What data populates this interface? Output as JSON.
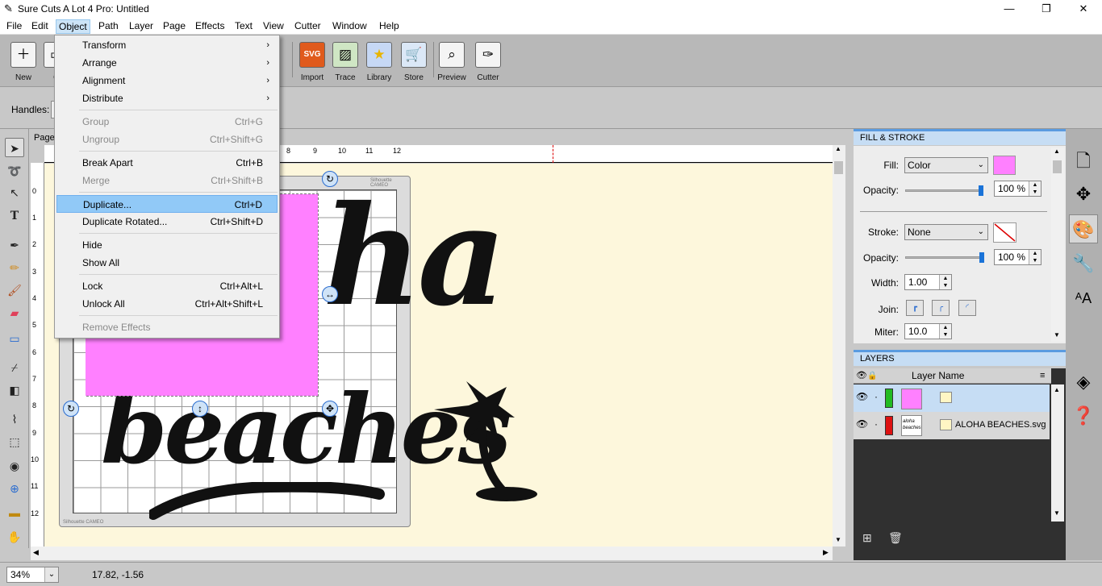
{
  "window": {
    "title": "Sure Cuts A Lot 4 Pro: Untitled",
    "min": "—",
    "max": "❐",
    "close": "✕"
  },
  "menubar": [
    "File",
    "Edit",
    "Object",
    "Path",
    "Layer",
    "Page",
    "Effects",
    "Text",
    "View",
    "Cutter",
    "Window",
    "Help"
  ],
  "toolbar": {
    "new": "New",
    "open": "O",
    "import": "Import",
    "trace": "Trace",
    "library": "Library",
    "store": "Store",
    "preview": "Preview",
    "cutter": "Cutter"
  },
  "props": {
    "handles_label": "Handles:"
  },
  "object_menu": [
    {
      "label": "Transform",
      "shortcut": "",
      "sub": true,
      "disabled": false
    },
    {
      "label": "Arrange",
      "shortcut": "",
      "sub": true,
      "disabled": false
    },
    {
      "label": "Alignment",
      "shortcut": "",
      "sub": true,
      "disabled": false
    },
    {
      "label": "Distribute",
      "shortcut": "",
      "sub": true,
      "disabled": false
    },
    {
      "label": "Group",
      "shortcut": "Ctrl+G",
      "disabled": true
    },
    {
      "label": "Ungroup",
      "shortcut": "Ctrl+Shift+G",
      "disabled": true
    },
    {
      "label": "Break Apart",
      "shortcut": "Ctrl+B",
      "disabled": false
    },
    {
      "label": "Merge",
      "shortcut": "Ctrl+Shift+B",
      "disabled": true
    },
    {
      "label": "Duplicate...",
      "shortcut": "Ctrl+D",
      "disabled": false,
      "highlighted": true
    },
    {
      "label": "Duplicate Rotated...",
      "shortcut": "Ctrl+Shift+D",
      "disabled": false
    },
    {
      "label": "Hide",
      "shortcut": "",
      "disabled": false
    },
    {
      "label": "Show All",
      "shortcut": "",
      "disabled": false
    },
    {
      "label": "Lock",
      "shortcut": "Ctrl+Alt+L",
      "disabled": false
    },
    {
      "label": "Unlock All",
      "shortcut": "Ctrl+Alt+Shift+L",
      "disabled": false
    },
    {
      "label": "Remove Effects",
      "shortcut": "",
      "disabled": true
    }
  ],
  "canvas": {
    "page_tab": "Page",
    "ruler_h": [
      "8",
      "9",
      "10",
      "11",
      "12"
    ],
    "ruler_v": [
      "0",
      "1",
      "2",
      "3",
      "4",
      "5",
      "6",
      "7",
      "8",
      "9",
      "10",
      "11",
      "12"
    ],
    "mat_brand": "Silhouette CAMEO",
    "art_text_top": "ha",
    "art_text_bottom": "beaches",
    "rect_color": "#ff80ff"
  },
  "fill_stroke": {
    "title": "FILL & STROKE",
    "fill_label": "Fill:",
    "fill_value": "Color",
    "fill_color": "#ff80ff",
    "opacity_label": "Opacity:",
    "fill_opacity": "100 %",
    "fill_opacity_level": 1.0,
    "stroke_label": "Stroke:",
    "stroke_value": "None",
    "stroke_opacity": "100 %",
    "stroke_opacity_level": 1.0,
    "width_label": "Width:",
    "width_value": "1.00",
    "join_label": "Join:",
    "miter_label": "Miter:",
    "miter_value": "10.0"
  },
  "layers": {
    "title": "LAYERS",
    "column": "Layer Name",
    "rows": [
      {
        "name": "",
        "color": "#22bb22"
      },
      {
        "name": "ALOHA BEACHES.svg",
        "color": "#dd1111",
        "thumb": "aloha beaches"
      }
    ]
  },
  "status": {
    "zoom": "34%",
    "coords": "17.82, -1.56"
  }
}
